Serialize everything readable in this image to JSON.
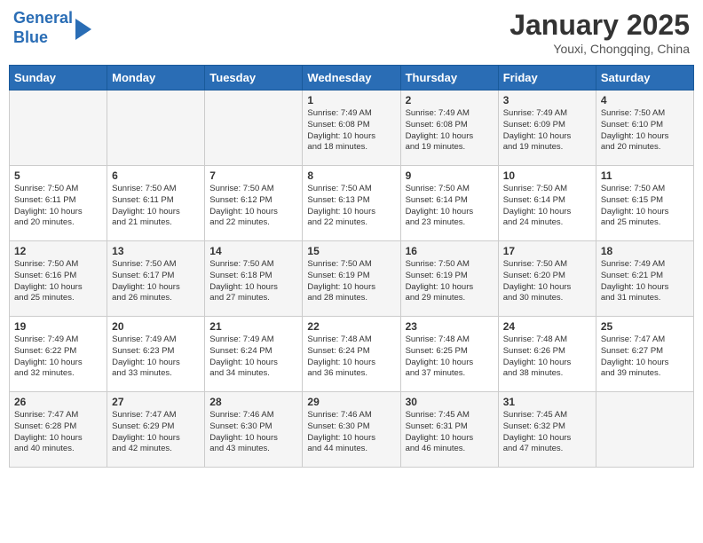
{
  "header": {
    "logo_line1": "General",
    "logo_line2": "Blue",
    "title": "January 2025",
    "subtitle": "Youxi, Chongqing, China"
  },
  "days_of_week": [
    "Sunday",
    "Monday",
    "Tuesday",
    "Wednesday",
    "Thursday",
    "Friday",
    "Saturday"
  ],
  "weeks": [
    [
      {
        "day": "",
        "info": ""
      },
      {
        "day": "",
        "info": ""
      },
      {
        "day": "",
        "info": ""
      },
      {
        "day": "1",
        "info": "Sunrise: 7:49 AM\nSunset: 6:08 PM\nDaylight: 10 hours\nand 18 minutes."
      },
      {
        "day": "2",
        "info": "Sunrise: 7:49 AM\nSunset: 6:08 PM\nDaylight: 10 hours\nand 19 minutes."
      },
      {
        "day": "3",
        "info": "Sunrise: 7:49 AM\nSunset: 6:09 PM\nDaylight: 10 hours\nand 19 minutes."
      },
      {
        "day": "4",
        "info": "Sunrise: 7:50 AM\nSunset: 6:10 PM\nDaylight: 10 hours\nand 20 minutes."
      }
    ],
    [
      {
        "day": "5",
        "info": "Sunrise: 7:50 AM\nSunset: 6:11 PM\nDaylight: 10 hours\nand 20 minutes."
      },
      {
        "day": "6",
        "info": "Sunrise: 7:50 AM\nSunset: 6:11 PM\nDaylight: 10 hours\nand 21 minutes."
      },
      {
        "day": "7",
        "info": "Sunrise: 7:50 AM\nSunset: 6:12 PM\nDaylight: 10 hours\nand 22 minutes."
      },
      {
        "day": "8",
        "info": "Sunrise: 7:50 AM\nSunset: 6:13 PM\nDaylight: 10 hours\nand 22 minutes."
      },
      {
        "day": "9",
        "info": "Sunrise: 7:50 AM\nSunset: 6:14 PM\nDaylight: 10 hours\nand 23 minutes."
      },
      {
        "day": "10",
        "info": "Sunrise: 7:50 AM\nSunset: 6:14 PM\nDaylight: 10 hours\nand 24 minutes."
      },
      {
        "day": "11",
        "info": "Sunrise: 7:50 AM\nSunset: 6:15 PM\nDaylight: 10 hours\nand 25 minutes."
      }
    ],
    [
      {
        "day": "12",
        "info": "Sunrise: 7:50 AM\nSunset: 6:16 PM\nDaylight: 10 hours\nand 25 minutes."
      },
      {
        "day": "13",
        "info": "Sunrise: 7:50 AM\nSunset: 6:17 PM\nDaylight: 10 hours\nand 26 minutes."
      },
      {
        "day": "14",
        "info": "Sunrise: 7:50 AM\nSunset: 6:18 PM\nDaylight: 10 hours\nand 27 minutes."
      },
      {
        "day": "15",
        "info": "Sunrise: 7:50 AM\nSunset: 6:19 PM\nDaylight: 10 hours\nand 28 minutes."
      },
      {
        "day": "16",
        "info": "Sunrise: 7:50 AM\nSunset: 6:19 PM\nDaylight: 10 hours\nand 29 minutes."
      },
      {
        "day": "17",
        "info": "Sunrise: 7:50 AM\nSunset: 6:20 PM\nDaylight: 10 hours\nand 30 minutes."
      },
      {
        "day": "18",
        "info": "Sunrise: 7:49 AM\nSunset: 6:21 PM\nDaylight: 10 hours\nand 31 minutes."
      }
    ],
    [
      {
        "day": "19",
        "info": "Sunrise: 7:49 AM\nSunset: 6:22 PM\nDaylight: 10 hours\nand 32 minutes."
      },
      {
        "day": "20",
        "info": "Sunrise: 7:49 AM\nSunset: 6:23 PM\nDaylight: 10 hours\nand 33 minutes."
      },
      {
        "day": "21",
        "info": "Sunrise: 7:49 AM\nSunset: 6:24 PM\nDaylight: 10 hours\nand 34 minutes."
      },
      {
        "day": "22",
        "info": "Sunrise: 7:48 AM\nSunset: 6:24 PM\nDaylight: 10 hours\nand 36 minutes."
      },
      {
        "day": "23",
        "info": "Sunrise: 7:48 AM\nSunset: 6:25 PM\nDaylight: 10 hours\nand 37 minutes."
      },
      {
        "day": "24",
        "info": "Sunrise: 7:48 AM\nSunset: 6:26 PM\nDaylight: 10 hours\nand 38 minutes."
      },
      {
        "day": "25",
        "info": "Sunrise: 7:47 AM\nSunset: 6:27 PM\nDaylight: 10 hours\nand 39 minutes."
      }
    ],
    [
      {
        "day": "26",
        "info": "Sunrise: 7:47 AM\nSunset: 6:28 PM\nDaylight: 10 hours\nand 40 minutes."
      },
      {
        "day": "27",
        "info": "Sunrise: 7:47 AM\nSunset: 6:29 PM\nDaylight: 10 hours\nand 42 minutes."
      },
      {
        "day": "28",
        "info": "Sunrise: 7:46 AM\nSunset: 6:30 PM\nDaylight: 10 hours\nand 43 minutes."
      },
      {
        "day": "29",
        "info": "Sunrise: 7:46 AM\nSunset: 6:30 PM\nDaylight: 10 hours\nand 44 minutes."
      },
      {
        "day": "30",
        "info": "Sunrise: 7:45 AM\nSunset: 6:31 PM\nDaylight: 10 hours\nand 46 minutes."
      },
      {
        "day": "31",
        "info": "Sunrise: 7:45 AM\nSunset: 6:32 PM\nDaylight: 10 hours\nand 47 minutes."
      },
      {
        "day": "",
        "info": ""
      }
    ]
  ]
}
